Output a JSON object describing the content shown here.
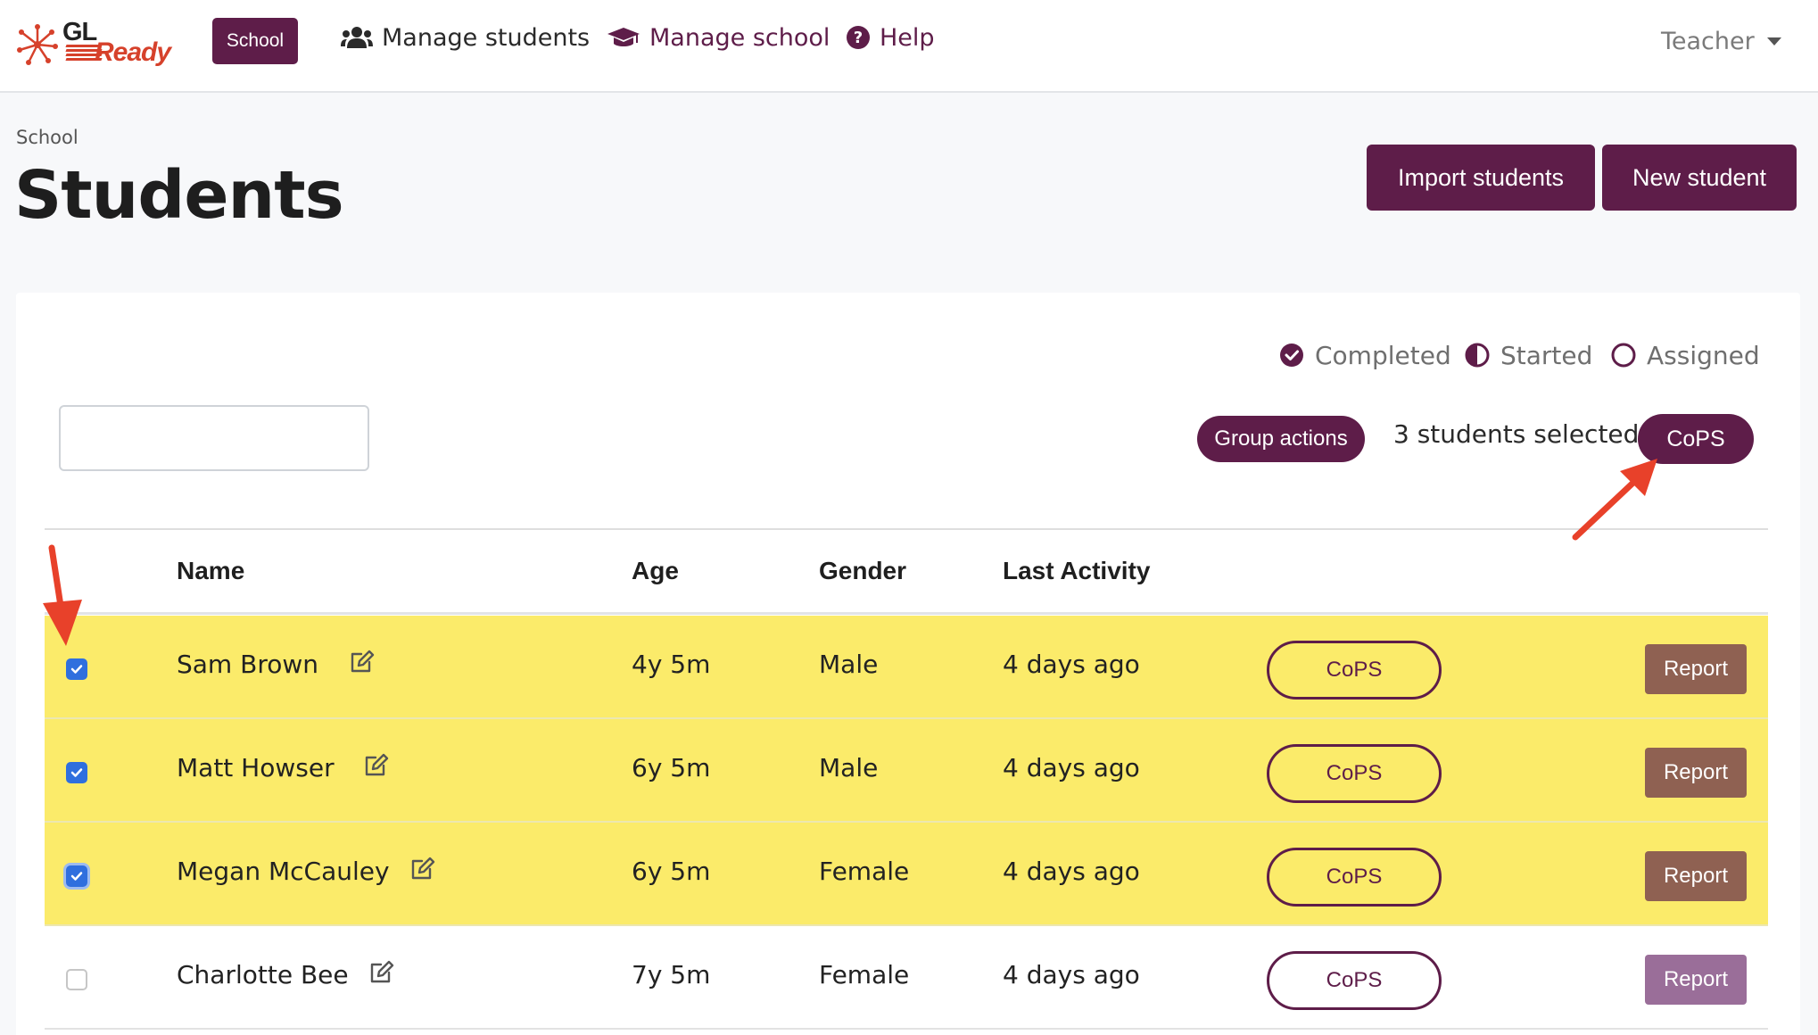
{
  "nav": {
    "logo_gl": "GL",
    "logo_ready": "Ready",
    "school_button": "School",
    "manage_students": "Manage students",
    "manage_school": "Manage school",
    "help": "Help",
    "user_menu": "Teacher"
  },
  "header": {
    "breadcrumb": "School",
    "title": "Students",
    "import_button": "Import students",
    "new_button": "New student"
  },
  "legend": {
    "completed": "Completed",
    "started": "Started",
    "assigned": "Assigned"
  },
  "toolbar": {
    "search_value": "",
    "group_actions": "Group actions",
    "selected_text": "3 students selected",
    "cops_button": "CoPS"
  },
  "table": {
    "headers": [
      "Name",
      "Age",
      "Gender",
      "Last Activity"
    ],
    "rows": [
      {
        "name": "Sam Brown",
        "age": "4y 5m",
        "gender": "Male",
        "last_activity": "4 days ago",
        "cops": "CoPS",
        "report": "Report",
        "selected": true
      },
      {
        "name": "Matt Howser",
        "age": "6y 5m",
        "gender": "Male",
        "last_activity": "4 days ago",
        "cops": "CoPS",
        "report": "Report",
        "selected": true
      },
      {
        "name": "Megan McCauley",
        "age": "6y 5m",
        "gender": "Female",
        "last_activity": "4 days ago",
        "cops": "CoPS",
        "report": "Report",
        "selected": true
      },
      {
        "name": "Charlotte Bee",
        "age": "7y 5m",
        "gender": "Female",
        "last_activity": "4 days ago",
        "cops": "CoPS",
        "report": "Report",
        "selected": false
      }
    ]
  },
  "colors": {
    "brand": "#5e1d49",
    "row_highlight": "#fbeb6a",
    "report": "#8f6152",
    "annotation_arrow": "#e8412a"
  }
}
